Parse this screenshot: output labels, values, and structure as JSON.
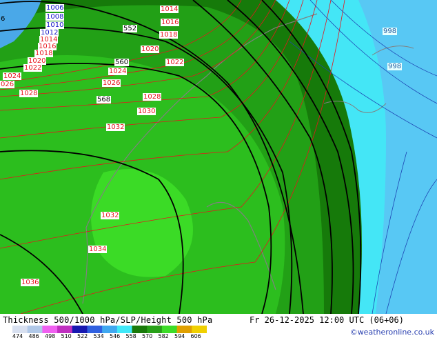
{
  "map": {
    "fill_colors": {
      "dark_green": "#1a7a0a",
      "mid_green": "#28a018",
      "green": "#2fc020",
      "bright_green": "#3ddc28",
      "cyan": "#40e8f8",
      "light_blue": "#49c8f0",
      "blue": "#4aa8e8"
    },
    "red_labels": [
      "1014",
      "1016",
      "1018",
      "1020",
      "1022",
      "1024",
      "1026",
      "1028",
      "1014",
      "1016",
      "1018",
      "1020",
      "1022",
      "1024",
      "1026",
      "1028",
      "1030",
      "1032",
      "1032",
      "1034",
      "1036"
    ],
    "blue_labels": [
      "1006",
      "1008",
      "1010",
      "1012"
    ],
    "cyan_labels": [
      "998",
      "998"
    ],
    "height_labels": [
      "552",
      "560",
      "568"
    ],
    "edge_labels": [
      "6",
      "026"
    ]
  },
  "footer": {
    "title": "Thickness 500/1000 hPa/SLP/Height 500 hPa",
    "datetime": "Fr 26-12-2025 12:00 UTC (06+06)",
    "credit": "©weatheronline.co.uk",
    "colorbar_ticks": [
      "474",
      "486",
      "498",
      "510",
      "522",
      "534",
      "546",
      "558",
      "570",
      "582",
      "594",
      "606"
    ],
    "colorbar_colors": [
      "#d8e0f0",
      "#b0c8e8",
      "#f060f0",
      "#c030c0",
      "#1818b0",
      "#3060e0",
      "#40a8f0",
      "#40e8f8",
      "#1a7a0a",
      "#28a018",
      "#3ddc28",
      "#e0a000",
      "#f0d000"
    ]
  }
}
